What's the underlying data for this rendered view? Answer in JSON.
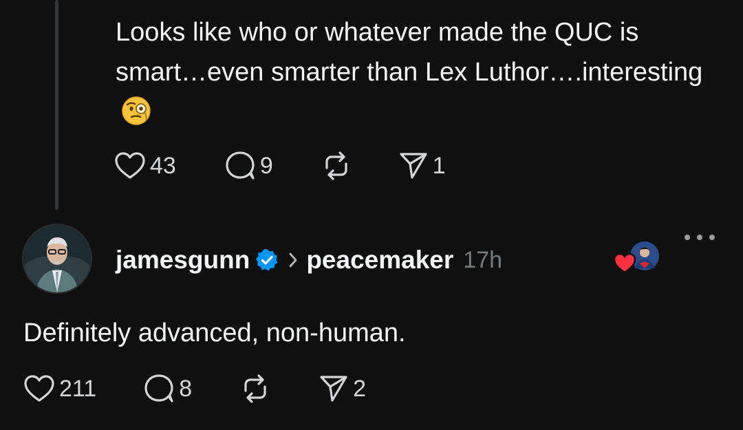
{
  "reply": {
    "text": "Looks like who or whatever made the QUC is smart…even smarter than Lex Luthor….interesting",
    "emoji_icon": "face-with-monocle-icon",
    "likes": "43",
    "comments": "9",
    "shares": "1"
  },
  "post": {
    "username": "jamesgunn",
    "verified_icon": "verified-badge-icon",
    "thread_name": "peacemaker",
    "time": "17h",
    "text": "Definitely advanced, non-human.",
    "likes": "211",
    "comments": "8",
    "shares": "2"
  },
  "icons": {
    "like": "heart-icon",
    "comment": "comment-icon",
    "repost": "repost-icon",
    "share": "send-icon",
    "more": "more-icon"
  },
  "colors": {
    "background": "#101010",
    "text": "#f3f5f7",
    "muted": "#777a7d",
    "verified": "#0095f6",
    "like_red": "#ff3040"
  }
}
